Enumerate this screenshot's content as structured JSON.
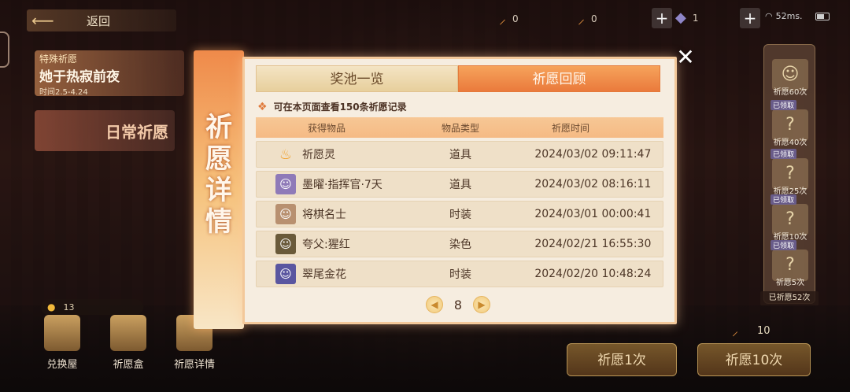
{
  "top_bar": {
    "back_label": "返回",
    "resources": [
      {
        "icon": "candle-icon",
        "value": "0"
      },
      {
        "icon": "wand-icon",
        "value": "0"
      },
      {
        "icon": "crystal-icon",
        "value": "1"
      }
    ],
    "ping": "52ms."
  },
  "left_panel": {
    "event_tag": "特殊祈愿",
    "event_title": "她于热寂前夜",
    "event_date": "时间2.5-4.24",
    "daily_label": "日常祈愿",
    "currency_value": "13",
    "menu": [
      {
        "label": "兑换屋",
        "icon": "shop-icon"
      },
      {
        "label": "祈愿盒",
        "icon": "box-icon"
      },
      {
        "label": "祈愿详情",
        "icon": "scroll-icon"
      }
    ]
  },
  "right_panel": {
    "milestones": [
      {
        "label": "祈愿60次",
        "claimed": ""
      },
      {
        "label": "祈愿40次",
        "claimed": "已领取"
      },
      {
        "label": "祈愿25次",
        "claimed": "已领取"
      },
      {
        "label": "祈愿10次",
        "claimed": "已领取"
      },
      {
        "label": "祈愿5次",
        "claimed": "已领取"
      }
    ],
    "total_label": "已祈愿52次",
    "ticket_count": "10",
    "wish_once": "祈愿1次",
    "wish_ten": "祈愿10次"
  },
  "modal": {
    "side_title": "祈愿详情",
    "tabs": [
      {
        "label": "奖池一览",
        "active": false
      },
      {
        "label": "祈愿回顾",
        "active": true
      }
    ],
    "hint": "可在本页面查看150条祈愿记录",
    "columns": [
      "获得物品",
      "物品类型",
      "祈愿时间"
    ],
    "rows": [
      {
        "item": "祈愿灵",
        "type": "道具",
        "time": "2024/03/02 09:11:47",
        "icon": "flame-icon",
        "color": "#f1a02a"
      },
      {
        "item": "墨曜·指挥官·7天",
        "type": "道具",
        "time": "2024/03/02 08:16:11",
        "icon": "avatar-icon",
        "color": "#8f7ab8"
      },
      {
        "item": "将棋名士",
        "type": "时装",
        "time": "2024/03/01 00:00:41",
        "icon": "avatar-icon",
        "color": "#b89070"
      },
      {
        "item": "夸父:猩红",
        "type": "染色",
        "time": "2024/02/21 16:55:30",
        "icon": "avatar-icon",
        "color": "#6a5a3a"
      },
      {
        "item": "翠尾金花",
        "type": "时装",
        "time": "2024/02/20 10:48:24",
        "icon": "avatar-icon",
        "color": "#5a56a0"
      }
    ],
    "page": "8",
    "close_icon": "close-icon"
  },
  "colors": {
    "accent": "#ea7a3c",
    "panel_bg": "#f6ede0",
    "header_bg": "#f5ba84"
  }
}
